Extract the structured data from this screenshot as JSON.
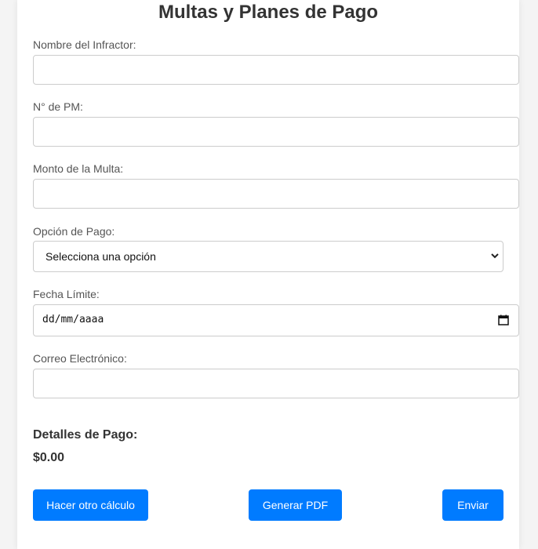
{
  "form": {
    "title": "Multas y Planes de Pago",
    "fields": {
      "name_label": "Nombre del Infractor:",
      "name_value": "",
      "pm_label": "N° de PM:",
      "pm_value": "",
      "amount_label": "Monto de la Multa:",
      "amount_value": "",
      "payment_label": "Opción de Pago:",
      "payment_selected": "Selecciona una opción",
      "date_label": "Fecha Límite:",
      "date_placeholder": "dd/mm/aaaa",
      "email_label": "Correo Electrónico:",
      "email_value": ""
    },
    "details": {
      "title": "Detalles de Pago:",
      "amount": "$0.00"
    },
    "buttons": {
      "recalc": "Hacer otro cálculo",
      "pdf": "Generar PDF",
      "send": "Enviar"
    },
    "icons": {
      "select": "chevron-down-icon",
      "date": "calendar-icon"
    },
    "colors": {
      "primary": "#007bff",
      "background": "#f4f4f4",
      "card": "#ffffff",
      "text": "#333333"
    }
  }
}
